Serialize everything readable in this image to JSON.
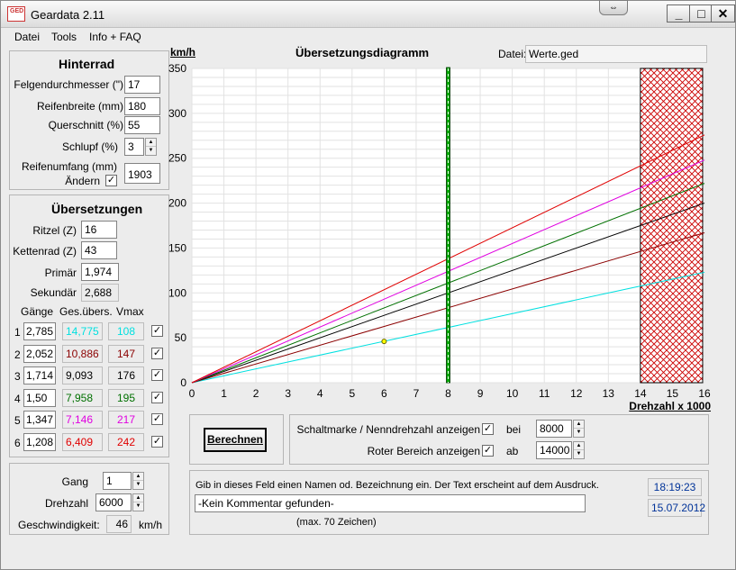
{
  "window": {
    "title": "Geardata 2.11",
    "icon_text": "GED"
  },
  "menu": [
    "Datei",
    "Tools",
    "Info + FAQ"
  ],
  "rear": {
    "title": "Hinterrad",
    "rim_label": "Felgendurchmesser (\")",
    "rim_value": "17",
    "width_label": "Reifenbreite (mm)",
    "width_value": "180",
    "profile_label": "Querschnitt (%)",
    "profile_value": "55",
    "slip_label": "Schlupf (%)",
    "slip_value": "3",
    "circ_label": "Reifenumfang (mm)",
    "change_label": "Ändern",
    "circ_value": "1903"
  },
  "ratios": {
    "title": "Übersetzungen",
    "pinion_label": "Ritzel (Z)",
    "pinion_value": "16",
    "sprocket_label": "Kettenrad (Z)",
    "sprocket_value": "43",
    "primary_label": "Primär",
    "primary_value": "1,974",
    "secondary_label": "Sekundär",
    "secondary_value": "2,688",
    "col_gears": "Gänge",
    "col_total": "Ges.übers.",
    "col_vmax": "Vmax",
    "gears": [
      {
        "n": "1",
        "ratio": "2,785",
        "total": "14,775",
        "vmax": "108",
        "color": "#00e0e0"
      },
      {
        "n": "2",
        "ratio": "2,052",
        "total": "10,886",
        "vmax": "147",
        "color": "#8b0000"
      },
      {
        "n": "3",
        "ratio": "1,714",
        "total": "9,093",
        "vmax": "176",
        "color": "#000000"
      },
      {
        "n": "4",
        "ratio": "1,50",
        "total": "7,958",
        "vmax": "195",
        "color": "#007000"
      },
      {
        "n": "5",
        "ratio": "1,347",
        "total": "7,146",
        "vmax": "217",
        "color": "#e000e0"
      },
      {
        "n": "6",
        "ratio": "1,208",
        "total": "6,409",
        "vmax": "242",
        "color": "#e00000"
      }
    ]
  },
  "calc": {
    "gear_label": "Gang",
    "gear_value": "1",
    "rpm_label": "Drehzahl",
    "rpm_value": "6000",
    "speed_label": "Geschwindigkeit:",
    "speed_value": "46",
    "speed_unit": "km/h"
  },
  "chart_header": {
    "unit": "km/h",
    "title": "Übersetzungsdiagramm",
    "file_label": "Datei:",
    "file_value": "Werte.ged"
  },
  "chart_data": {
    "type": "line",
    "title": "Übersetzungsdiagramm",
    "ylabel": "km/h",
    "xlabel": "Drehzahl x 1000",
    "xlim": [
      0,
      16
    ],
    "ylim": [
      0,
      350
    ],
    "xticks": [
      0,
      1,
      2,
      3,
      4,
      5,
      6,
      7,
      8,
      9,
      10,
      11,
      12,
      13,
      14,
      15,
      16
    ],
    "yticks": [
      0,
      50,
      100,
      150,
      200,
      250,
      300,
      350
    ],
    "grid": true,
    "series": [
      {
        "color": "#00e0e0",
        "x": [
          0,
          16
        ],
        "y": [
          0,
          123
        ]
      },
      {
        "color": "#8b0000",
        "x": [
          0,
          16
        ],
        "y": [
          0,
          167
        ]
      },
      {
        "color": "#000000",
        "x": [
          0,
          16
        ],
        "y": [
          0,
          200
        ]
      },
      {
        "color": "#007000",
        "x": [
          0,
          16
        ],
        "y": [
          0,
          222
        ]
      },
      {
        "color": "#e000e0",
        "x": [
          0,
          16
        ],
        "y": [
          0,
          248
        ]
      },
      {
        "color": "#e00000",
        "x": [
          0,
          16
        ],
        "y": [
          0,
          276
        ]
      }
    ],
    "shift_marker_x": 8,
    "red_zone_from": 14,
    "point": {
      "x": 6,
      "y": 46
    }
  },
  "calc_button": "Berechnen",
  "options": {
    "shift_label": "Schaltmarke / Nenndrehzahl anzeigen",
    "shift_at": "bei",
    "shift_value": "8000",
    "red_label": "Roter Bereich anzeigen",
    "red_from": "ab",
    "red_value": "14000"
  },
  "comment": {
    "hint": "Gib in dieses Feld einen Namen od. Bezeichnung ein. Der Text erscheint auf dem Ausdruck.",
    "value": "-Kein Kommentar gefunden-",
    "max_note": "(max. 70 Zeichen)",
    "time": "18:19:23",
    "date": "15.07.2012"
  }
}
